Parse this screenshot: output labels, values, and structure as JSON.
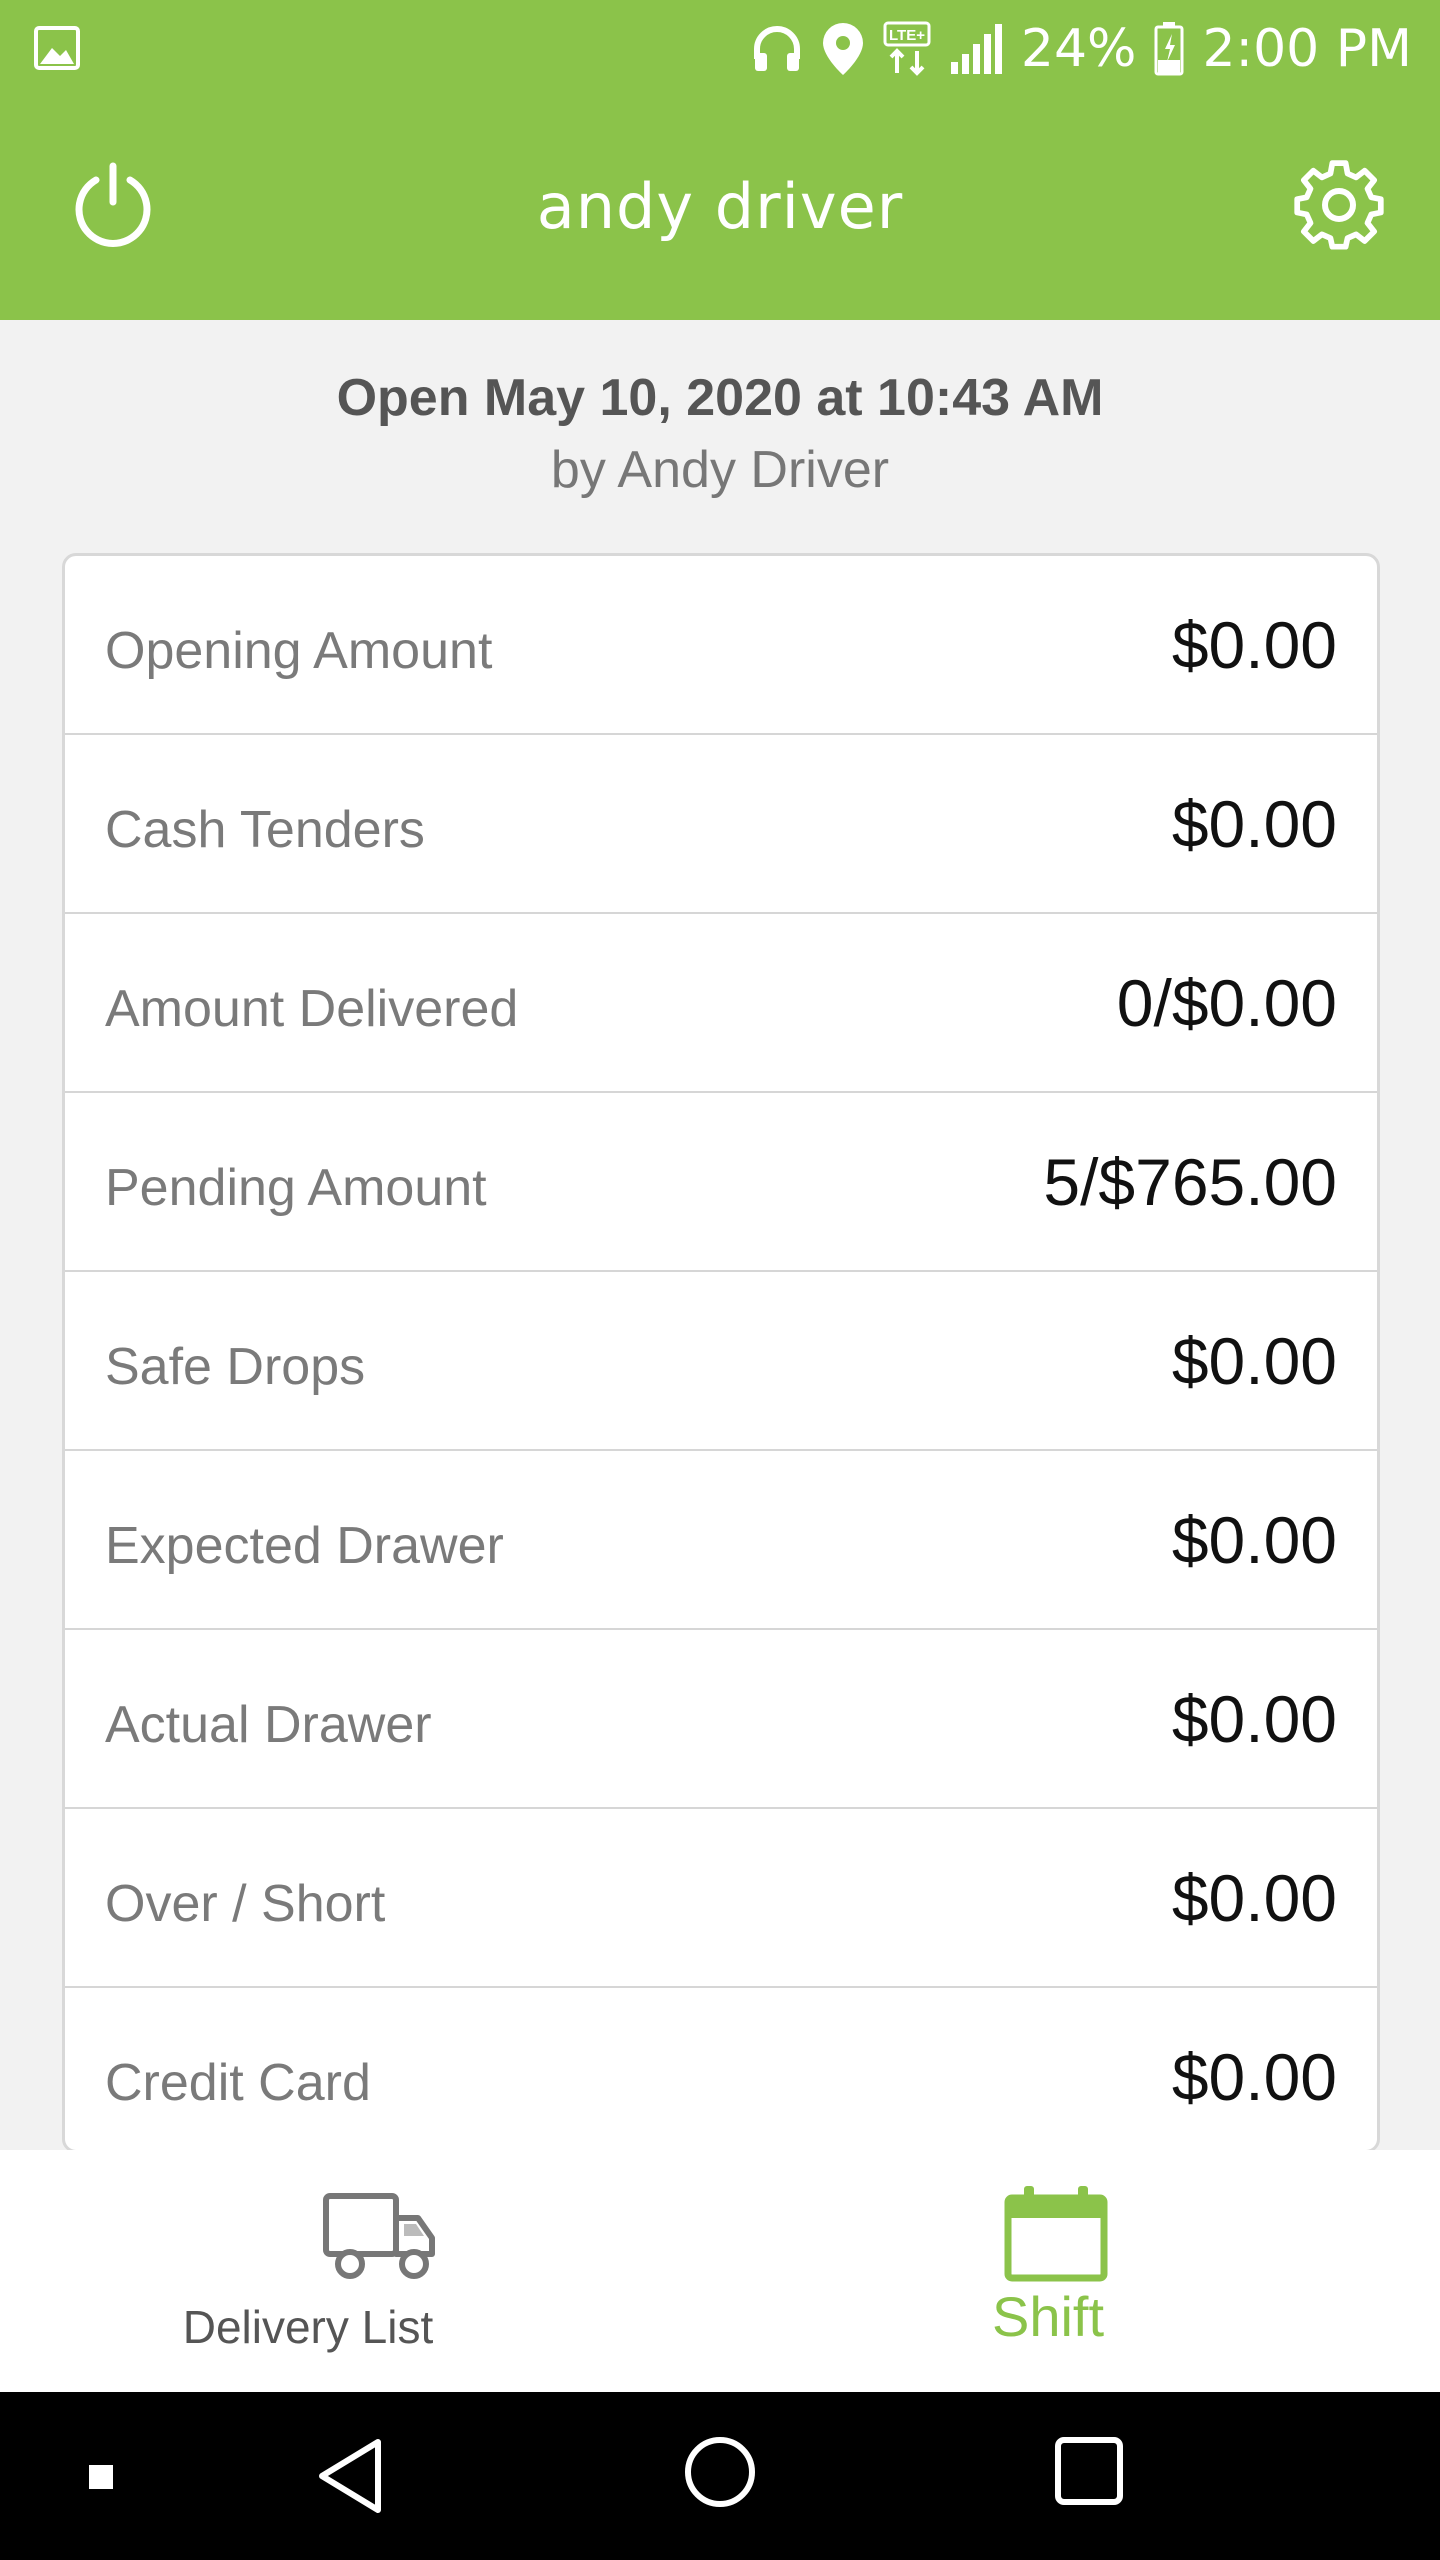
{
  "status_bar": {
    "battery": "24%",
    "time": "2:00 PM",
    "icons": [
      "gallery-icon",
      "headphones-icon",
      "location-icon",
      "lte-icon",
      "signal-icon",
      "battery-icon"
    ]
  },
  "app_bar": {
    "title": "andy driver",
    "left_icon": "power-icon",
    "right_icon": "gear-icon",
    "color": "#8bc34a"
  },
  "shift": {
    "opened": "Open May 10, 2020 at 10:43 AM",
    "by": "by Andy Driver"
  },
  "summary": [
    {
      "label": "Opening Amount",
      "value": "$0.00"
    },
    {
      "label": "Cash Tenders",
      "value": "$0.00"
    },
    {
      "label": "Amount Delivered",
      "value": "0/$0.00"
    },
    {
      "label": "Pending Amount",
      "value": "5/$765.00"
    },
    {
      "label": "Safe Drops",
      "value": "$0.00"
    },
    {
      "label": "Expected Drawer",
      "value": "$0.00"
    },
    {
      "label": "Actual Drawer",
      "value": "$0.00"
    },
    {
      "label": "Over / Short",
      "value": "$0.00"
    },
    {
      "label": "Credit Card",
      "value": "$0.00"
    }
  ],
  "bottom_nav": {
    "items": [
      {
        "label": "Delivery List",
        "icon": "truck-icon",
        "active": false
      },
      {
        "label": "Shift",
        "icon": "calendar-icon",
        "active": true
      }
    ],
    "active_color": "#8bc34a"
  },
  "system_nav": {
    "icons": [
      "recent-dot-icon",
      "back-icon",
      "home-icon",
      "overview-icon"
    ]
  }
}
